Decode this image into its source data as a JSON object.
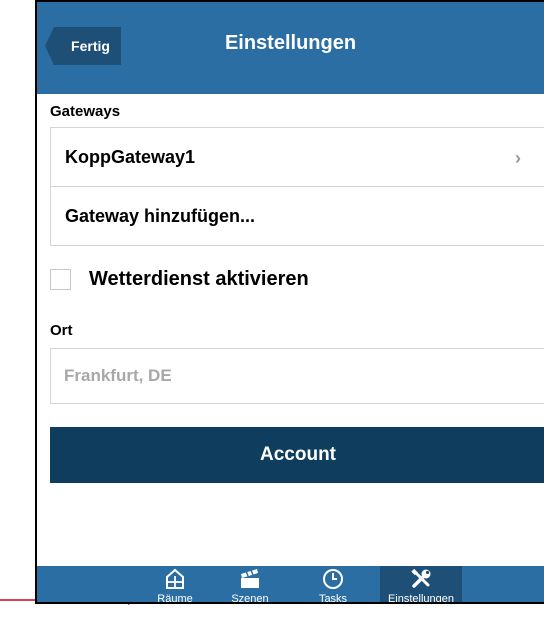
{
  "header": {
    "back_label": "Fertig",
    "title": "Einstellungen"
  },
  "gateways": {
    "section_label": "Gateways",
    "items": [
      {
        "label": "KoppGateway1"
      }
    ],
    "add_label": "Gateway hinzufügen..."
  },
  "weather": {
    "checkbox_label": "Wetterdienst aktivieren",
    "checked": false
  },
  "location": {
    "section_label": "Ort",
    "placeholder": "Frankfurt, DE"
  },
  "account_button": "Account",
  "tabs": [
    {
      "label": "Räume",
      "icon": "house-icon"
    },
    {
      "label": "Szenen",
      "icon": "clapperboard-icon"
    },
    {
      "label": "Tasks",
      "icon": "clock-icon"
    },
    {
      "label": "Einstellungen",
      "icon": "tools-icon",
      "active": true
    }
  ],
  "colors": {
    "navbar": "#2a6ea3",
    "back_button": "#1d4f77",
    "account_button": "#0e3d5e",
    "annotation_arrow": "#d0021b"
  }
}
